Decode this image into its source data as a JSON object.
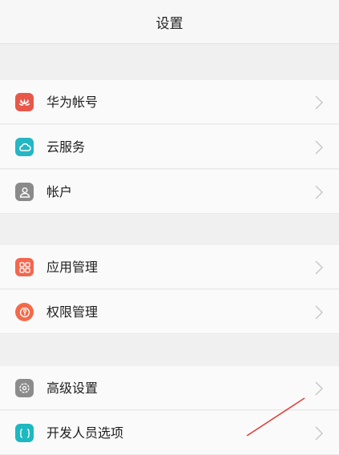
{
  "header": {
    "title": "设置"
  },
  "items": [
    {
      "label": "华为帐号",
      "icon": "huawei-logo-icon",
      "color": "#e8584a"
    },
    {
      "label": "云服务",
      "icon": "cloud-icon",
      "color": "#25b6c3"
    },
    {
      "label": "帐户",
      "icon": "account-icon",
      "color": "#8a8a8a"
    },
    {
      "label": "应用管理",
      "icon": "apps-icon",
      "color": "#f2674f"
    },
    {
      "label": "权限管理",
      "icon": "permission-icon",
      "color": "#f26a4a"
    },
    {
      "label": "高级设置",
      "icon": "advanced-settings-icon",
      "color": "#8c8c8c"
    },
    {
      "label": "开发人员选项",
      "icon": "developer-icon",
      "color": "#1eb8c0"
    }
  ],
  "colors": {
    "accent_arrow": "#e0403a",
    "chevron": "#c6c6c6"
  }
}
